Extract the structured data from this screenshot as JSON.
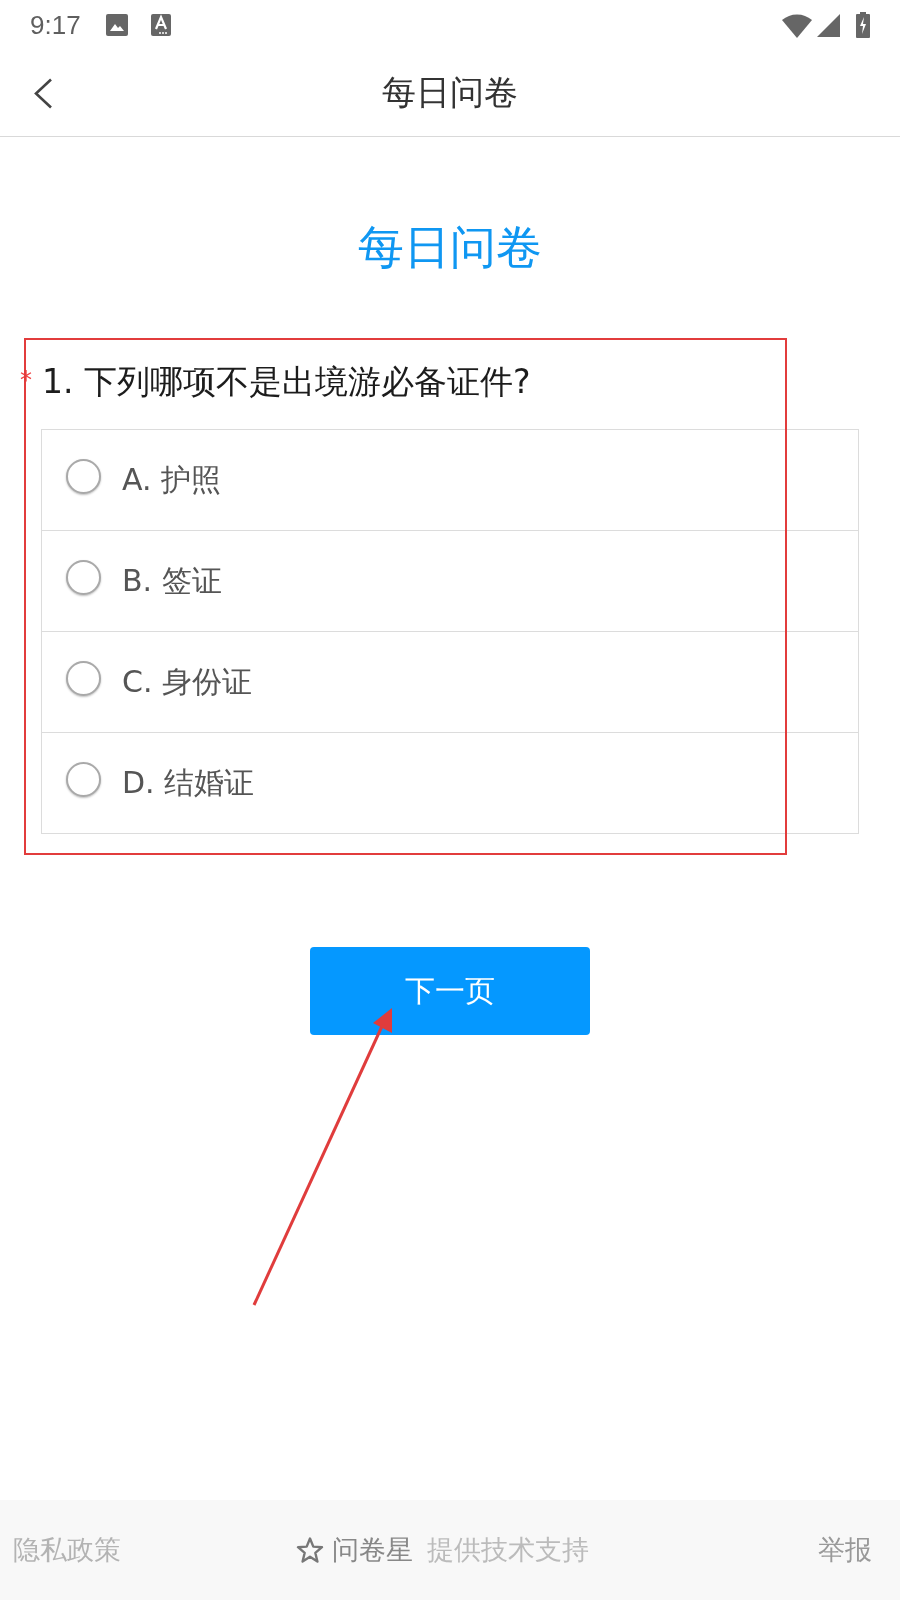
{
  "status_bar": {
    "time": "9:17"
  },
  "app_bar": {
    "title": "每日问卷"
  },
  "survey": {
    "heading": "每日问卷",
    "questions": [
      {
        "required_mark": "*",
        "title": "1. 下列哪项不是出境游必备证件?",
        "options": [
          {
            "label": "A. 护照",
            "selected": false
          },
          {
            "label": "B. 签证",
            "selected": false
          },
          {
            "label": "C. 身份证",
            "selected": false
          },
          {
            "label": "D. 结婚证",
            "selected": false
          }
        ]
      }
    ],
    "next_button": "下一页"
  },
  "footer": {
    "privacy_link": "隐私政策",
    "brand": "问卷星",
    "credit": "提供技术支持",
    "report_link": "举报"
  }
}
